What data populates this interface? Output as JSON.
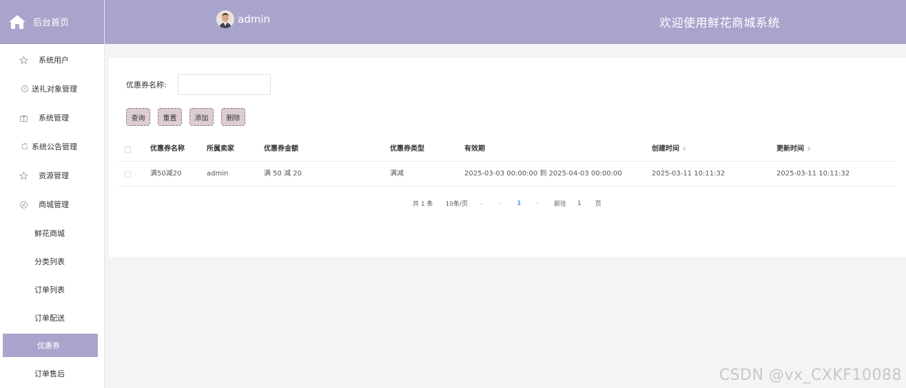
{
  "sidebar": {
    "home_label": "后台首页",
    "items": [
      {
        "label": "系统用户",
        "icon": "star-outline-icon"
      },
      {
        "label": "送礼对象管理",
        "icon": "clock-icon"
      },
      {
        "label": "系统管理",
        "icon": "gift-box-icon"
      },
      {
        "label": "系统公告管理",
        "icon": "refresh-icon"
      },
      {
        "label": "资源管理",
        "icon": "star-outline-icon"
      },
      {
        "label": "商城管理",
        "icon": "compass-icon"
      }
    ],
    "sub_items": [
      {
        "label": "鲜花商城"
      },
      {
        "label": "分类列表"
      },
      {
        "label": "订单列表"
      },
      {
        "label": "订单配送"
      },
      {
        "label": "优惠券",
        "active": true
      },
      {
        "label": "订单售后"
      }
    ]
  },
  "header": {
    "username": "admin",
    "welcome": "欢迎使用鲜花商城系统",
    "color": "#a9a4cc"
  },
  "search": {
    "label": "优惠券名称:",
    "value": "",
    "placeholder": ""
  },
  "buttons": {
    "query": "查询",
    "reset": "重置",
    "add": "添加",
    "delete": "删除"
  },
  "table": {
    "columns": [
      "优惠券名称",
      "所属卖家",
      "优惠券金额",
      "优惠券类型",
      "有效期",
      "创建时间",
      "更新时间"
    ],
    "rows": [
      [
        "满50减20",
        "admin",
        "满 50 减 20",
        "满减",
        "2025-03-03 00:00:00 到 2025-04-03 00:00:00",
        "2025-03-11 10:11:32",
        "2025-03-11 10:11:32"
      ]
    ]
  },
  "pagination": {
    "total": "共 1 条",
    "page_size": "10条/页",
    "current_page": "1",
    "goto_label": "前往",
    "goto_value": "1",
    "page_unit": "页"
  },
  "watermark": "CSDN @vx_CXKF10088"
}
